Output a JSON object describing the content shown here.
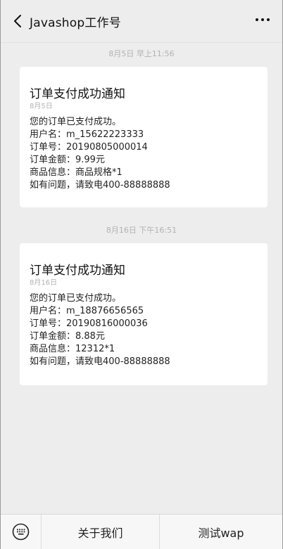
{
  "header": {
    "title": "Javashop工作号"
  },
  "messages": [
    {
      "timestamp": "8月5日 早上11:56",
      "title": "订单支付成功通知",
      "date": "8月5日",
      "lines": [
        "您的订单已支付成功。",
        "用户名：m_15622223333",
        "订单号：20190805000014",
        "订单金额：9.99元",
        "商品信息：商品规格*1",
        "如有问题，请致电400-88888888"
      ]
    },
    {
      "timestamp": "8月16日 下午16:51",
      "title": "订单支付成功通知",
      "date": "8月16日",
      "lines": [
        "您的订单已支付成功。",
        "用户名：m_18876656565",
        "订单号：20190816000036",
        "订单金额：8.88元",
        "商品信息：12312*1",
        "如有问题，请致电400-88888888"
      ]
    }
  ],
  "footer": {
    "keyboard_icon": "keyboard-icon",
    "menu": [
      {
        "label": "关于我们"
      },
      {
        "label": "测试wap"
      }
    ]
  },
  "colors": {
    "background": "#ededed",
    "card": "#ffffff",
    "muted_text": "#b2b2b2"
  }
}
